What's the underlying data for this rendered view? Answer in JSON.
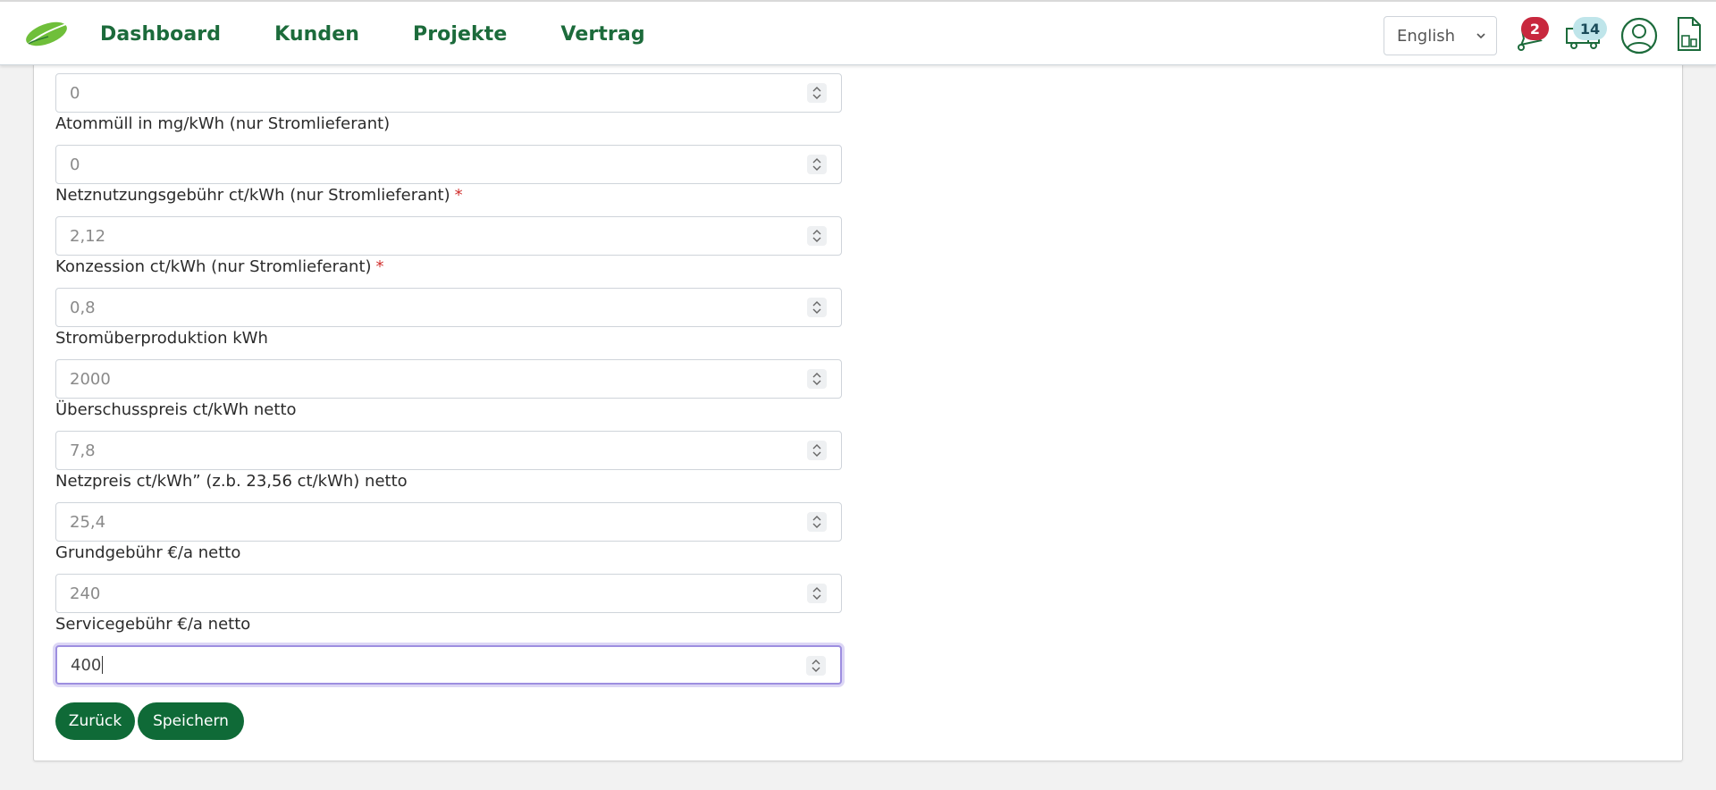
{
  "nav": {
    "links": [
      "Dashboard",
      "Kunden",
      "Projekte",
      "Vertrag"
    ],
    "language": "English",
    "notifications_count": "2",
    "deliveries_count": "14"
  },
  "form": {
    "fields": [
      {
        "label": "",
        "value": "0",
        "required": false
      },
      {
        "label": "Atommüll in mg/kWh (nur Stromlieferant)",
        "value": "0",
        "required": false
      },
      {
        "label": "Netznutzungsgebühr ct/kWh (nur Stromlieferant)",
        "value": "2,12",
        "required": true
      },
      {
        "label": "Konzession ct/kWh (nur Stromlieferant)",
        "value": "0,8",
        "required": true
      },
      {
        "label": "Stromüberproduktion kWh",
        "value": "2000",
        "required": false
      },
      {
        "label": "Überschusspreis ct/kWh netto",
        "value": "7,8",
        "required": false
      },
      {
        "label": "Netzpreis ct/kWh” (z.b. 23,56 ct/kWh) netto",
        "value": "25,4",
        "required": false
      },
      {
        "label": "Grundgebühr €/a netto",
        "value": "240",
        "required": false
      },
      {
        "label": "Servicegebühr €/a netto",
        "value": "400",
        "required": false
      }
    ],
    "required_mark": "*",
    "buttons": {
      "back": "Zurück",
      "save": "Speichern"
    }
  },
  "colors": {
    "brand_green": "#1c6b3b",
    "button_green": "#0f6a37",
    "badge_red": "#c8283e",
    "badge_teal": "#bfe5ea",
    "focus_border": "#9d8ee0"
  },
  "icons": [
    "leaf-logo",
    "bell-icon",
    "truck-icon",
    "user-icon",
    "document-icon",
    "chevron-down-icon"
  ]
}
